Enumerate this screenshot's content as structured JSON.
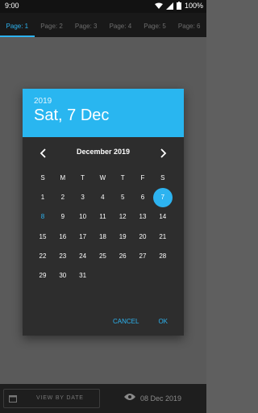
{
  "status_bar": {
    "time": "9:00",
    "battery": "100%"
  },
  "tabs": [
    "Page: 1",
    "Page: 2",
    "Page: 3",
    "Page: 4",
    "Page: 5",
    "Page: 6"
  ],
  "dialog": {
    "year": "2019",
    "selected_date": "Sat, 7 Dec",
    "month_label": "December 2019",
    "weekdays": [
      "S",
      "M",
      "T",
      "W",
      "T",
      "F",
      "S"
    ],
    "days": [
      "1",
      "2",
      "3",
      "4",
      "5",
      "6",
      "7",
      "8",
      "9",
      "10",
      "11",
      "12",
      "13",
      "14",
      "15",
      "16",
      "17",
      "18",
      "19",
      "20",
      "21",
      "22",
      "23",
      "24",
      "25",
      "26",
      "27",
      "28",
      "29",
      "30",
      "31"
    ],
    "cancel_label": "CANCEL",
    "ok_label": "OK"
  },
  "bottom": {
    "view_button_label": "VIEW BY DATE",
    "date_label": "08 Dec 2019"
  },
  "colors": {
    "accent": "#2db3f0",
    "header": "#29b6f0",
    "dialog_bg": "#2d2d2d"
  },
  "icons": [
    "wifi-icon",
    "signal-icon",
    "battery-icon",
    "chevron-left-icon",
    "chevron-right-icon",
    "calendar-icon",
    "eye-icon"
  ]
}
